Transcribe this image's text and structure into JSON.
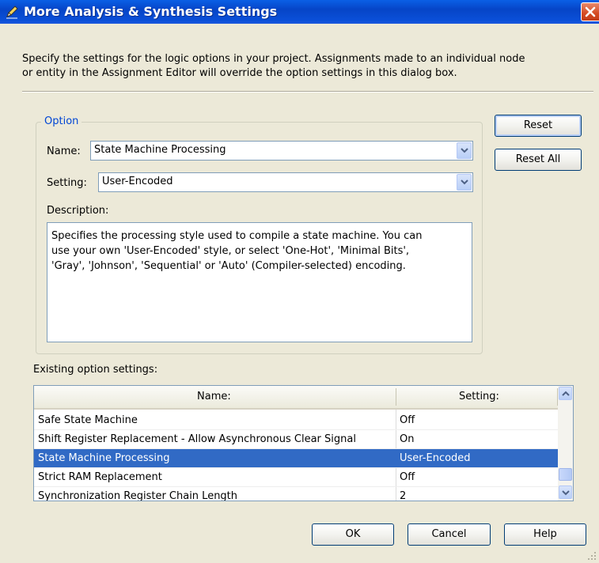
{
  "window": {
    "title": "More Analysis & Synthesis Settings"
  },
  "intro": {
    "line1": "Specify the settings for the logic options in your project.  Assignments made to an individual node",
    "line2": "or entity in the Assignment Editor will override the option settings in this dialog box."
  },
  "option_group": {
    "legend": "Option",
    "name_label": "Name:",
    "name_value": "State Machine Processing",
    "setting_label": "Setting:",
    "setting_value": "User-Encoded",
    "description_label": "Description:",
    "description_lines": [
      "Specifies the processing style used to compile a state machine. You can",
      "use your own 'User-Encoded' style, or select 'One-Hot', 'Minimal Bits',",
      "'Gray', 'Johnson', 'Sequential' or 'Auto' (Compiler-selected) encoding."
    ]
  },
  "buttons": {
    "reset": "Reset",
    "reset_all": "Reset All",
    "ok": "OK",
    "cancel": "Cancel",
    "help": "Help"
  },
  "existing": {
    "label": "Existing option settings:",
    "columns": [
      "Name:",
      "Setting:"
    ],
    "rows": [
      {
        "name": "Safe State Machine",
        "setting": "Off"
      },
      {
        "name": "Shift Register Replacement - Allow Asynchronous Clear Signal",
        "setting": "On"
      },
      {
        "name": "State Machine Processing",
        "setting": "User-Encoded",
        "selected": true
      },
      {
        "name": "Strict RAM Replacement",
        "setting": "Off"
      },
      {
        "name": "Synchronization Register Chain Length",
        "setting": "2"
      }
    ]
  },
  "colors": {
    "titlebar": "#0a4fd8",
    "dialog_bg": "#ece9d8",
    "selection": "#316ac5",
    "group_legend": "#0046d5"
  }
}
